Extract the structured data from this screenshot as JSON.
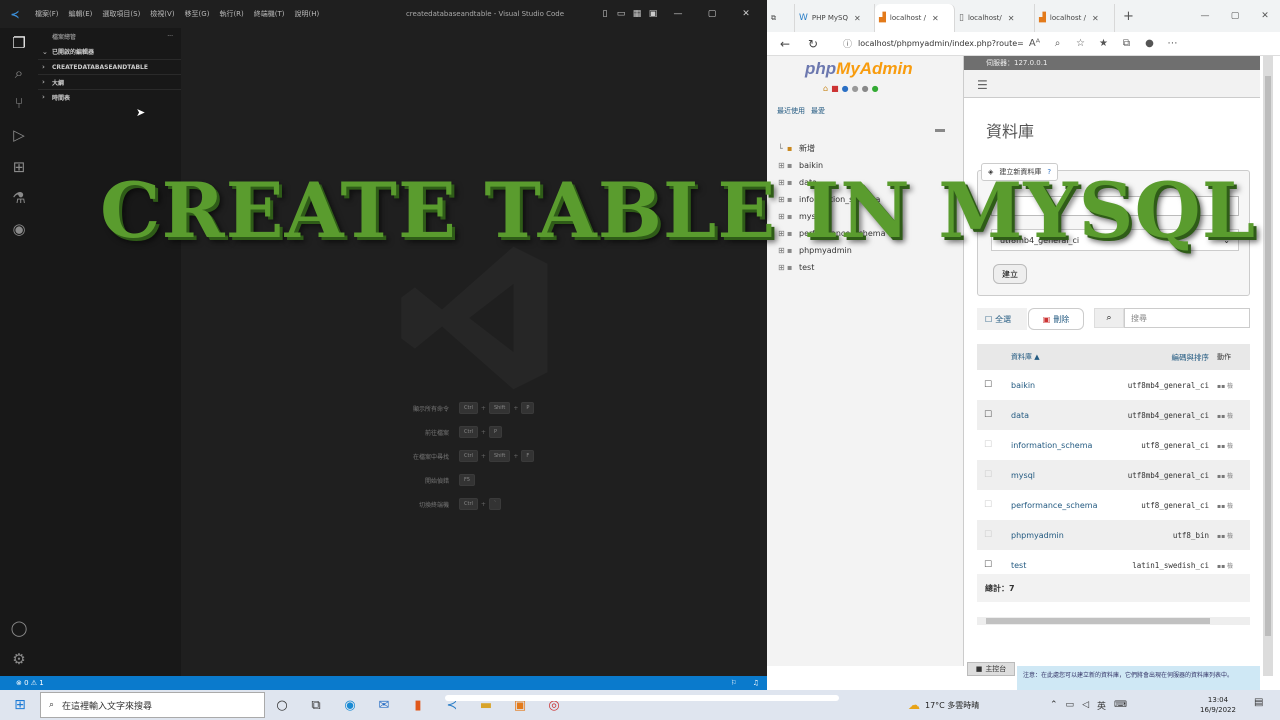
{
  "overlay": {
    "title": "CREATE TABLE IN MYSQL"
  },
  "vscode": {
    "menu": [
      "檔案(F)",
      "編輯(E)",
      "選取項目(S)",
      "檢視(V)",
      "移至(G)",
      "執行(R)",
      "終端機(T)",
      "說明(H)"
    ],
    "window_title": "createdatabaseandtable - Visual Studio Code",
    "sidebar": {
      "header": "檔案總管",
      "more": "···",
      "sections": [
        "已開啟的編輯器",
        "CREATEDATABASEANDTABLE",
        "大綱",
        "時間表"
      ]
    },
    "shortcuts": [
      {
        "label": "顯示所有命令",
        "keys": [
          "Ctrl",
          "Shift",
          "P"
        ]
      },
      {
        "label": "前往檔案",
        "keys": [
          "Ctrl",
          "P"
        ]
      },
      {
        "label": "在檔案中尋找",
        "keys": [
          "Ctrl",
          "Shift",
          "F"
        ]
      },
      {
        "label": "開始偵錯",
        "keys": [
          "F5"
        ]
      },
      {
        "label": "切換終端機",
        "keys": [
          "Ctrl",
          "`"
        ]
      }
    ],
    "status": {
      "left": "⊗ 0 ⚠ 1"
    }
  },
  "browser": {
    "tabs": [
      {
        "label": "PHP MySQ",
        "active": false
      },
      {
        "label": "localhost /",
        "active": true
      },
      {
        "label": "localhost/",
        "active": false
      },
      {
        "label": "localhost /",
        "active": false
      }
    ],
    "url": "localhost/phpmyadmin/index.php?route=/server..."
  },
  "pma": {
    "logo_php": "php",
    "logo_myadmin": "MyAdmin",
    "nav_tabs": [
      "最近使用",
      "最愛"
    ],
    "tree": [
      {
        "name": "新增"
      },
      {
        "name": "baikin"
      },
      {
        "name": "data"
      },
      {
        "name": "information_schema"
      },
      {
        "name": "mysql"
      },
      {
        "name": "performance_schema"
      },
      {
        "name": "phpmyadmin"
      },
      {
        "name": "test"
      }
    ],
    "server_bar": "伺服器：127.0.0.1",
    "page_title": "資料庫",
    "create_legend": "建立新資料庫",
    "collation_value": "utf8mb4_general_ci",
    "create_button": "建立",
    "check_all": "全選",
    "delete_button": "刪除",
    "filter_placeholder": "搜尋",
    "table_headers": {
      "name": "資料庫 ▲",
      "collation": "編碼與排序",
      "action": "動作"
    },
    "databases": [
      {
        "name": "baikin",
        "collation": "utf8mb4_general_ci"
      },
      {
        "name": "data",
        "collation": "utf8mb4_general_ci"
      },
      {
        "name": "information_schema",
        "collation": "utf8_general_ci"
      },
      {
        "name": "mysql",
        "collation": "utf8mb4_general_ci"
      },
      {
        "name": "performance_schema",
        "collation": "utf8_general_ci"
      },
      {
        "name": "phpmyadmin",
        "collation": "utf8_bin"
      },
      {
        "name": "test",
        "collation": "latin1_swedish_ci"
      }
    ],
    "row_action": "▪▪ 檢",
    "total": "總計：7",
    "console_tab": "主控台",
    "console_msg": "注意：在此處您可以建立新的資料庫，它們將會出現在伺服器的資料庫列表中。"
  },
  "taskbar": {
    "search_placeholder": "在這裡輸入文字來搜尋",
    "weather": "17°C 多雲時晴",
    "ime": "英",
    "time": "13:04",
    "date": "16/9/2022"
  }
}
